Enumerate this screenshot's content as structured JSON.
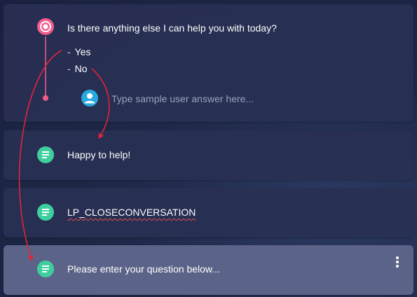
{
  "question": {
    "text": "Is there anything else I can help you with today?",
    "options": [
      "Yes",
      "No"
    ],
    "option_dash": "-",
    "user_answer_placeholder": "Type sample user answer here..."
  },
  "cards": [
    {
      "text": "Happy to help!"
    },
    {
      "text": "LP_CLOSECONVERSATION"
    },
    {
      "text": "Please enter your question below..."
    }
  ],
  "icons": {
    "question": "radio-target-icon",
    "user": "user-avatar-icon",
    "text_message": "text-lines-icon",
    "menu": "more-vertical-icon"
  },
  "colors": {
    "accent_pink": "#f25c8d",
    "message_green": "#3fcf9f",
    "user_blue": "#29a9e1",
    "arrow_red": "#e0243a"
  }
}
